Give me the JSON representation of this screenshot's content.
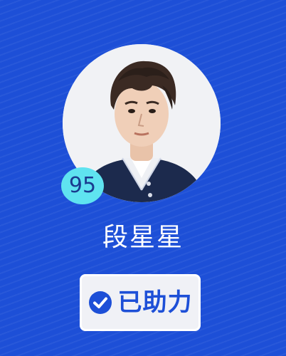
{
  "profile": {
    "score": "95",
    "name": "段星星",
    "avatar_icon": "portrait-photo"
  },
  "action": {
    "label": "已助力",
    "icon": "check-circle-icon",
    "state": "assisted"
  },
  "colors": {
    "background": "#1d4fd7",
    "badge": "#5fe3f0",
    "button_bg": "#f0f1f6",
    "accent": "#1d4fd7",
    "text_light": "#ffffff"
  }
}
